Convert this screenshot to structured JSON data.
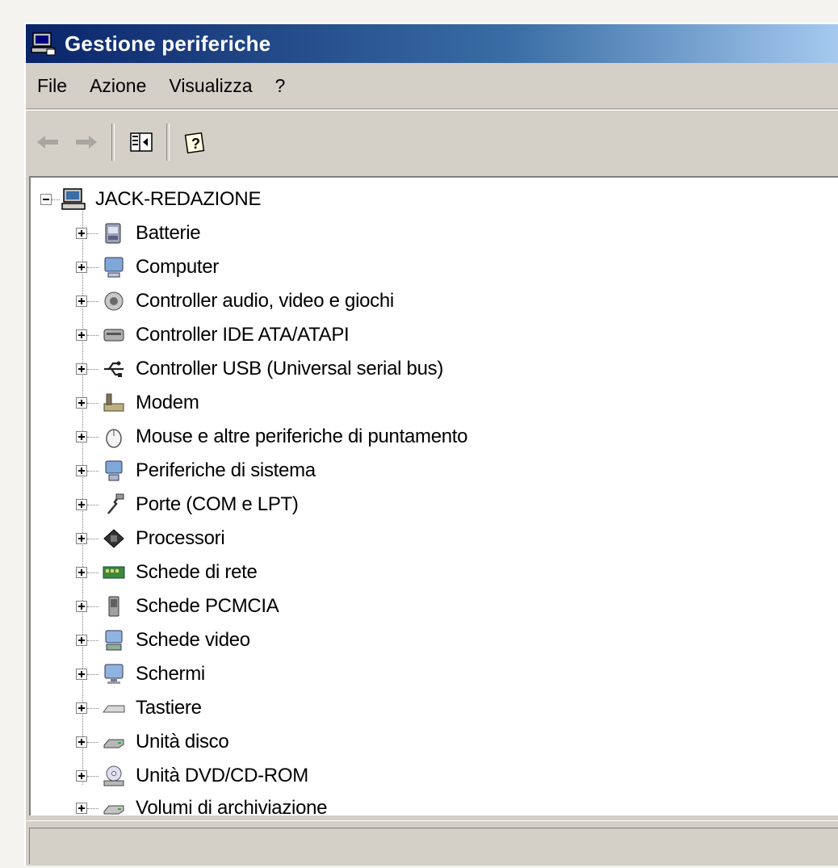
{
  "window": {
    "title": "Gestione periferiche"
  },
  "menu": [
    {
      "label": "File"
    },
    {
      "label": "Azione"
    },
    {
      "label": "Visualizza"
    },
    {
      "label": "?"
    }
  ],
  "toolbar": {
    "icons": [
      "back-arrow-icon",
      "forward-arrow-icon",
      "show-hide-console-tree-icon",
      "help-icon"
    ]
  },
  "tree": {
    "root": {
      "label": "JACK-REDAZIONE",
      "icon": "computer-icon"
    },
    "items": [
      {
        "label": "Batterie",
        "icon": "battery-icon"
      },
      {
        "label": "Computer",
        "icon": "computer-icon"
      },
      {
        "label": "Controller audio, video e giochi",
        "icon": "audio-icon"
      },
      {
        "label": "Controller IDE ATA/ATAPI",
        "icon": "ide-controller-icon"
      },
      {
        "label": "Controller USB (Universal serial bus)",
        "icon": "usb-icon"
      },
      {
        "label": "Modem",
        "icon": "modem-icon"
      },
      {
        "label": "Mouse e altre periferiche di puntamento",
        "icon": "mouse-icon"
      },
      {
        "label": "Periferiche di sistema",
        "icon": "system-device-icon"
      },
      {
        "label": "Porte (COM e LPT)",
        "icon": "port-icon"
      },
      {
        "label": "Processori",
        "icon": "processor-icon"
      },
      {
        "label": "Schede di rete",
        "icon": "network-card-icon"
      },
      {
        "label": "Schede PCMCIA",
        "icon": "pcmcia-icon"
      },
      {
        "label": "Schede video",
        "icon": "display-adapter-icon"
      },
      {
        "label": "Schermi",
        "icon": "monitor-icon"
      },
      {
        "label": "Tastiere",
        "icon": "keyboard-icon"
      },
      {
        "label": "Unità disco",
        "icon": "disk-drive-icon"
      },
      {
        "label": "Unità DVD/CD-ROM",
        "icon": "dvd-drive-icon"
      },
      {
        "label": "Volumi di archiviazione",
        "icon": "storage-volume-icon"
      }
    ]
  },
  "statusbar": {
    "text": ""
  }
}
